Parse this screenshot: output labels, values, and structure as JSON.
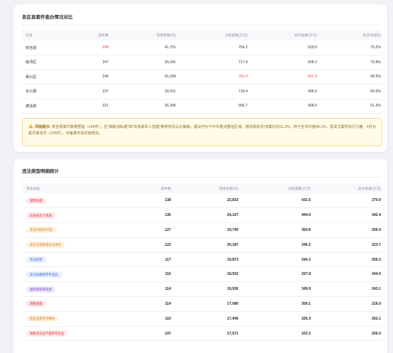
{
  "district_compare": {
    "title": "各区县案件查办情况对比",
    "headers": [
      "区县",
      "案件数",
      "违停金额(元)",
      "涉案金额(万元)",
      "处罚金额(万元)",
      "处罚/涉案比"
    ],
    "rows": [
      {
        "district": "安吉县",
        "cases": "249",
        "amount": "41,701",
        "involved": "754.2",
        "penalty": "529.6",
        "ratio": "70.2%"
      },
      {
        "district": "南浔区",
        "cases": "247",
        "amount": "39,341",
        "involved": "717.4",
        "penalty": "508.2",
        "ratio": "70.8%"
      },
      {
        "district": "吴兴区",
        "cases": "246",
        "amount": "41,036",
        "involved": "761.3",
        "penalty": "521.9",
        "ratio": "68.5%"
      },
      {
        "district": "长兴县",
        "cases": "237",
        "amount": "39,261",
        "involved": "718.4",
        "penalty": "495.6",
        "ratio": "69.0%"
      },
      {
        "district": "德清县",
        "cases": "221",
        "amount": "36,396",
        "involved": "665.7",
        "penalty": "408.0",
        "ratio": "61.3%"
      }
    ],
    "alert": {
      "icon": "warning-icon",
      "label": "风险提示:",
      "text": "安吉县案件数量居首（249件），且\"销售违私烟\"和\"向未成年人售烟\"两类违法占比偏高。建议作为下半年重点整治区域。德清县处罚/涉案比仅61.3%，低于全市均值68.1%，需关注案件执行力度。4月为案件高发月（225件），可备季市违法趋势向。"
    }
  },
  "violation_types": {
    "title": "违法类型明细统计",
    "headers": [
      "违法类型",
      "案件数",
      "违停金额(元)",
      "涉案金额(万元)",
      "处罚金额(万元)"
    ],
    "rows": [
      {
        "type": "销售私烟",
        "color": "red",
        "cases": "138",
        "amount": "22,833",
        "involved": "432.5",
        "penalty": "270.9"
      },
      {
        "type": "向未成年人售烟",
        "color": "red",
        "cases": "135",
        "amount": "24,127",
        "involved": "444.0",
        "penalty": "342.4"
      },
      {
        "type": "无证/伪造许可证",
        "color": "orange",
        "cases": "127",
        "amount": "19,745",
        "involved": "354.8",
        "penalty": "200.0"
      },
      {
        "type": "未在当地批发企业进货",
        "color": "orange",
        "cases": "122",
        "amount": "20,187",
        "involved": "346.2",
        "penalty": "223.7"
      },
      {
        "type": "无证经营",
        "color": "blue",
        "cases": "117",
        "amount": "19,873",
        "involved": "344.3",
        "penalty": "256.2"
      },
      {
        "type": "非法运输烟草专卖品",
        "color": "blue",
        "cases": "116",
        "amount": "18,932",
        "involved": "337.8",
        "penalty": "244.0"
      },
      {
        "type": "超限量邮寄卷烟",
        "color": "purple",
        "cases": "114",
        "amount": "19,936",
        "involved": "349.9",
        "penalty": "243.1"
      },
      {
        "type": "销售假烟",
        "color": "red",
        "cases": "114",
        "amount": "17,086",
        "involved": "359.1",
        "penalty": "216.0"
      },
      {
        "type": "擅自变更许可事项",
        "color": "orange",
        "cases": "110",
        "amount": "17,945",
        "involved": "325.3",
        "penalty": "262.1"
      },
      {
        "type": "销售非法生产烟草专卖品",
        "color": "red",
        "cases": "107",
        "amount": "17,071",
        "involved": "323.3",
        "penalty": "205.0"
      }
    ]
  },
  "colors": {
    "highlight_red": "#e53935",
    "alert_bg": "#fffbe8",
    "alert_border": "#f5d98c"
  }
}
